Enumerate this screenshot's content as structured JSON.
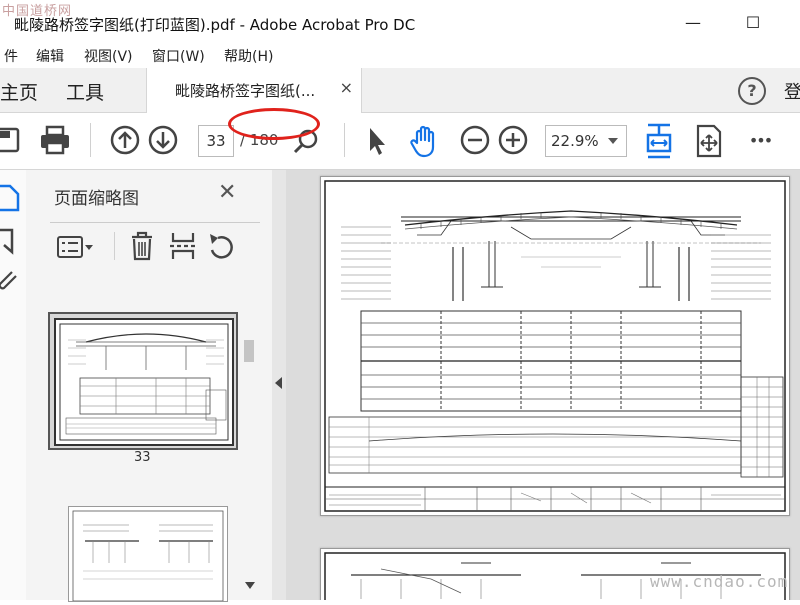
{
  "watermark": {
    "top_left": "中国道桥网",
    "bottom_right": "www.cndao.com"
  },
  "window": {
    "title": "毗陵路桥签字图纸(打印蓝图).pdf - Adobe Acrobat Pro DC",
    "minimize": "—",
    "maximize": "☐"
  },
  "menu": {
    "items": [
      "件",
      "编辑",
      "视图(V)",
      "窗口(W)",
      "帮助(H)"
    ]
  },
  "tabs": {
    "home": "主页",
    "tools": "工具",
    "document": "毗陵路桥签字图纸(...",
    "close": "×"
  },
  "header": {
    "help": "?",
    "login": "登"
  },
  "toolbar": {
    "current_page": "33",
    "total_pages": "/ 180",
    "zoom": "22.9%",
    "more": "•••"
  },
  "panel": {
    "title": "页面缩略图",
    "close": "✕",
    "thumbnail_page": "33"
  },
  "colors": {
    "accent": "#1473e6",
    "annotation": "#e0221c"
  }
}
